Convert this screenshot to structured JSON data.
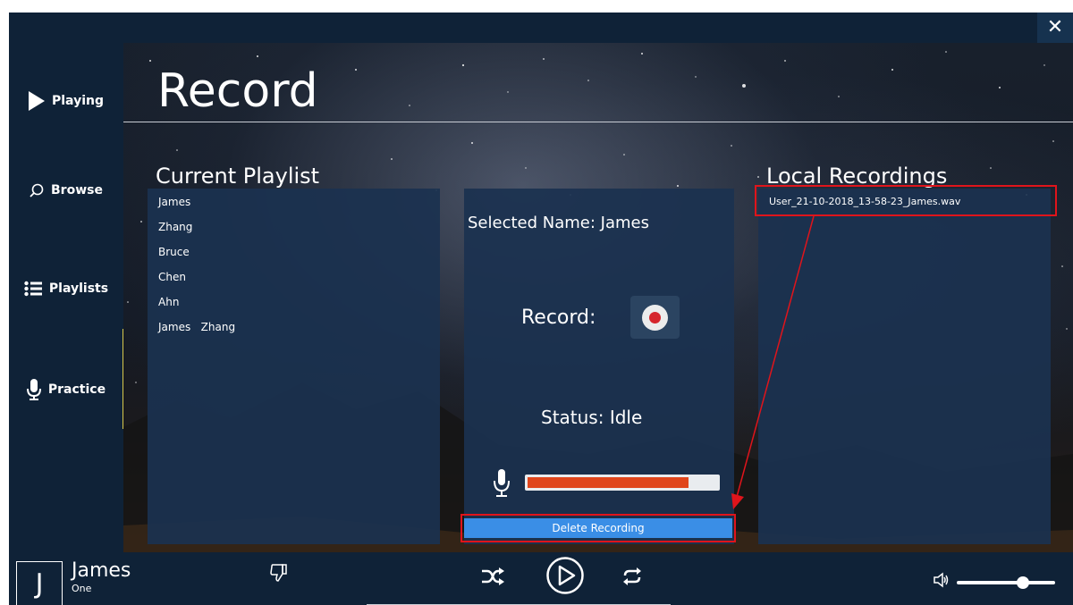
{
  "window": {
    "close_glyph": "✕"
  },
  "sidebar": {
    "items": [
      {
        "label": "Playing",
        "icon": "play-icon"
      },
      {
        "label": "Browse",
        "icon": "search-icon"
      },
      {
        "label": "Playlists",
        "icon": "list-icon"
      },
      {
        "label": "Practice",
        "icon": "microphone-icon",
        "active": true
      }
    ]
  },
  "page": {
    "title": "Record"
  },
  "playlist": {
    "title": "Current Playlist",
    "items": [
      "James",
      "Zhang",
      "Bruce",
      "Chen",
      "Ahn",
      "James   Zhang"
    ]
  },
  "recorder": {
    "selected_name": "Selected Name: James",
    "record_label": "Record:",
    "status": "Status: Idle",
    "input_level_percent": 85,
    "delete_label": "Delete Recording"
  },
  "recordings": {
    "title": "Local Recordings",
    "items": [
      "User_21-10-2018_13-58-23_James.wav"
    ]
  },
  "player": {
    "avatar_letter": "J",
    "track_title": "James",
    "track_artist": "One",
    "volume_percent": 67
  },
  "colors": {
    "accent": "#3a8ee6",
    "highlight": "#e0141b",
    "record_red": "#d6252c",
    "level_fill": "#e0461c",
    "active_indicator": "#d8c84a"
  }
}
